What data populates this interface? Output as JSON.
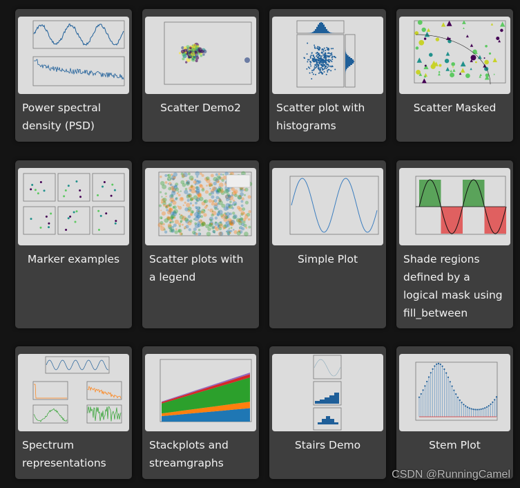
{
  "gallery": [
    {
      "title": "Power spectral density (PSD)",
      "thumb": "psd-plot"
    },
    {
      "title": "Scatter Demo2",
      "thumb": "scatter-demo2"
    },
    {
      "title": "Scatter plot with histograms",
      "thumb": "scatter-hist"
    },
    {
      "title": "Scatter Masked",
      "thumb": "scatter-masked"
    },
    {
      "title": "Marker examples",
      "thumb": "marker-grid"
    },
    {
      "title": "Scatter plots with a legend",
      "thumb": "scatter-legend"
    },
    {
      "title": "Simple Plot",
      "thumb": "simple-sine"
    },
    {
      "title": "Shade regions defined by a logical mask using fill_between",
      "thumb": "fill-between"
    },
    {
      "title": "Spectrum representations",
      "thumb": "spectrum"
    },
    {
      "title": "Stackplots and streamgraphs",
      "thumb": "stackplot"
    },
    {
      "title": "Stairs Demo",
      "thumb": "stairs"
    },
    {
      "title": "Stem Plot",
      "thumb": "stem"
    }
  ],
  "watermark": "CSDN @RunningCamel",
  "colors": {
    "page_bg": "#141414",
    "card_bg": "#3e3e3e",
    "thumb_bg": "#dcdcdc",
    "plot_blue": "#1f77b4",
    "green": "#5aa35a",
    "red": "#e06060",
    "orange": "#ff7f0e"
  }
}
